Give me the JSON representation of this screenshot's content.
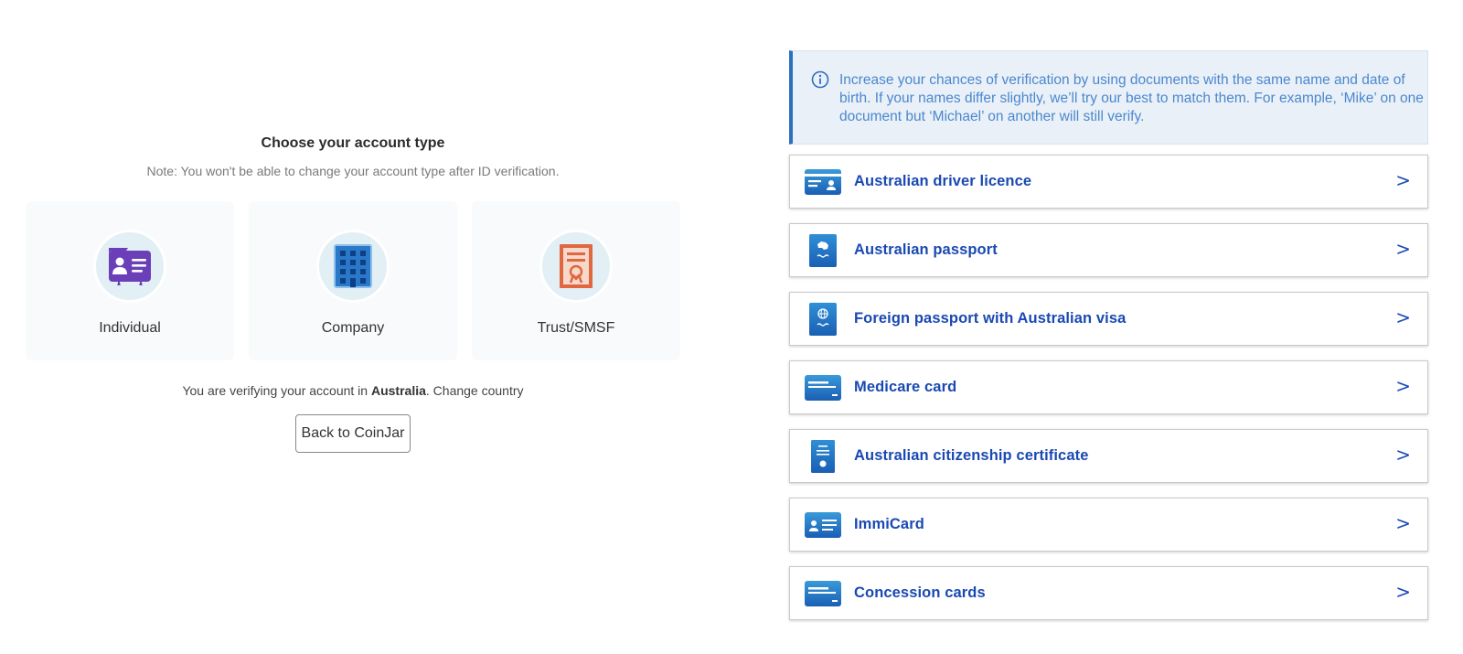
{
  "account": {
    "title": "Choose your account type",
    "note": "Note: You won't be able to change your account type after ID verification.",
    "types": [
      {
        "label": "Individual",
        "icon": "id-card-icon"
      },
      {
        "label": "Company",
        "icon": "building-icon"
      },
      {
        "label": "Trust/SMSF",
        "icon": "certificate-icon"
      }
    ],
    "country_prefix": "You are verifying your account in ",
    "country": "Australia",
    "country_suffix": ". ",
    "change_country": "Change country",
    "back_button": "Back to CoinJar"
  },
  "info": {
    "text": "Increase your chances of verification by using documents with the same name and date of birth. If your names differ slightly, we’ll try our best to match them. For example, ‘Mike’ on one document but ‘Michael’ on another will still verify."
  },
  "documents": [
    {
      "label": "Australian driver licence",
      "icon": "driver-licence-icon",
      "chevron": ">"
    },
    {
      "label": "Australian passport",
      "icon": "passport-icon",
      "chevron": ">"
    },
    {
      "label": "Foreign passport with Australian visa",
      "icon": "foreign-passport-icon",
      "chevron": ">"
    },
    {
      "label": "Medicare card",
      "icon": "medicare-card-icon",
      "chevron": ">"
    },
    {
      "label": "Australian citizenship certificate",
      "icon": "citizenship-certificate-icon",
      "chevron": ">"
    },
    {
      "label": "ImmiCard",
      "icon": "immicard-icon",
      "chevron": ">"
    },
    {
      "label": "Concession cards",
      "icon": "concession-card-icon",
      "chevron": ">"
    }
  ],
  "colors": {
    "accent": "#1a49b3",
    "info_bg": "#eaf0f7",
    "info_border": "#2e6fc2",
    "info_text": "#4a88cf",
    "individual_icon": "#6a3fb8",
    "company_icon": "#2a78c8",
    "trust_icon": "#e0673f"
  }
}
